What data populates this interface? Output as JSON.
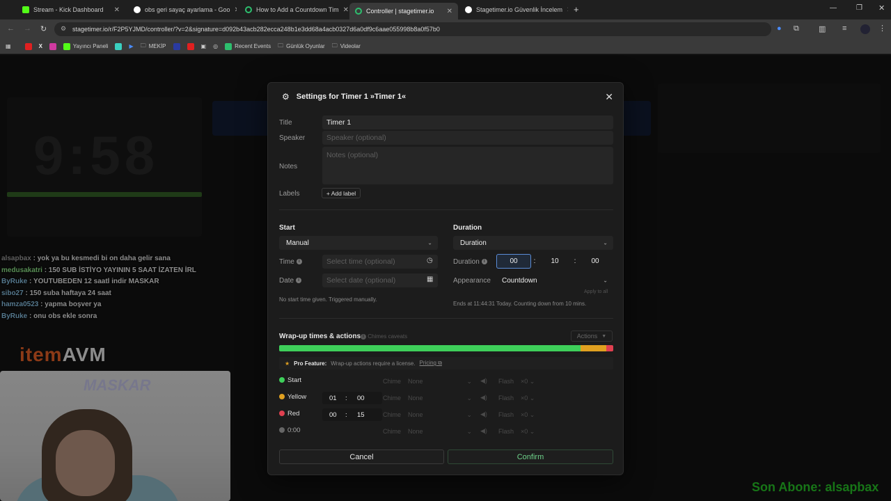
{
  "browser": {
    "tabs": [
      {
        "title": "Stream - Kick Dashboard",
        "color": "#53fc18"
      },
      {
        "title": "obs geri sayaç ayarlama - Goo",
        "color": "#ffffff"
      },
      {
        "title": "How to Add a Countdown Tim",
        "color": "#2dbf6e"
      },
      {
        "title": "Controller | stagetimer.io",
        "color": "#2dbf6e"
      },
      {
        "title": "Stagetimer.io Güvenlik İncelem",
        "color": "#ffffff"
      }
    ],
    "url": "stagetimer.io/r/F2P5YJMD/controller/?v=2&signature=d092b43acb282ecca248b1e3dd68a4acb0327d6a0df9c6aae055998b8a0f57b0",
    "bookmarks": [
      "Yayıncı Paneli",
      "MEKİP",
      "Recent Events",
      "Günlük Oyunlar",
      "Videolar"
    ]
  },
  "background": {
    "timer": "9:58",
    "chat": [
      {
        "user": "alsapbax",
        "text": " : yok ya bu kesmedi bi on daha gelir sana"
      },
      {
        "user": "medusakatri",
        "text": " : 150 SUB İSTİYO YAYININ 5 SAAT İZATEN İRL"
      },
      {
        "user": "ByRuke",
        "text": " : YOUTUBEDEN 12 saatl indir MASKAR"
      },
      {
        "user": "sibo27",
        "text": " : 150 suba haftaya 24 saat"
      },
      {
        "user": "hamza0523",
        "text": " : yapma boşver ya"
      },
      {
        "user": "ByRuke",
        "text": " : onu obs ekle sonra"
      }
    ],
    "logo_prefix": "item",
    "logo_suffix": "AVM",
    "webcam_sign": "MASKAR",
    "sub_ticker": "Son Abone: alsapbax"
  },
  "modal": {
    "title": "Settings for Timer 1 »Timer 1«",
    "title_label": "Title",
    "title_value": "Timer 1",
    "speaker_label": "Speaker",
    "speaker_placeholder": "Speaker (optional)",
    "notes_label": "Notes",
    "notes_placeholder": "Notes (optional)",
    "labels_label": "Labels",
    "add_label": "+ Add label",
    "start": {
      "heading": "Start",
      "mode": "Manual",
      "time_label": "Time",
      "time_placeholder": "Select time (optional)",
      "date_label": "Date",
      "date_placeholder": "Select date (optional)",
      "note": "No start time given. Triggered manually."
    },
    "duration": {
      "heading": "Duration",
      "mode": "Duration",
      "label": "Duration",
      "hours": "00",
      "minutes": "10",
      "seconds": "00",
      "appearance_label": "Appearance",
      "appearance": "Countdown",
      "apply_all": "Apply to all",
      "note": "Ends at 11:44:31 Today. Counting down from 10 mins."
    },
    "wrapup": {
      "heading": "Wrap-up times & actions",
      "chimes": "Chimes caveats",
      "actions": "Actions",
      "pro_feature": "Pro Feature:",
      "pro_text": "Wrap-up actions require a license.",
      "pricing": "Pricing",
      "bar": {
        "green": 0.903,
        "yellow": 0.076,
        "red": 0.021
      },
      "rows": [
        {
          "label": "Start",
          "color": "#3ecf5a",
          "mm": "",
          "ss": ""
        },
        {
          "label": "Yellow",
          "color": "#e0a020",
          "mm": "01",
          "ss": "00"
        },
        {
          "label": "Red",
          "color": "#e04050",
          "mm": "00",
          "ss": "15"
        },
        {
          "label": "0:00",
          "color": "#666666",
          "mm": "",
          "ss": ""
        }
      ],
      "chime_label": "Chime",
      "chime_value": "None",
      "flash_label": "Flash",
      "flash_value": "×0"
    },
    "cancel": "Cancel",
    "confirm": "Confirm"
  }
}
